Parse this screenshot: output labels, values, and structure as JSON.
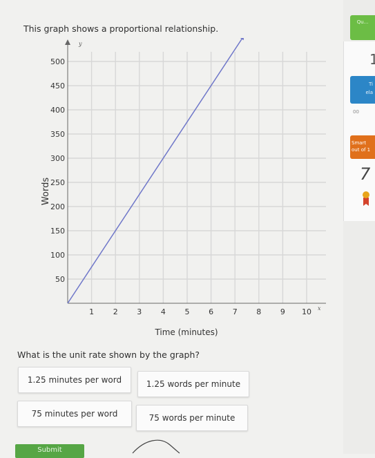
{
  "question": {
    "prompt": "This graph shows a proportional relationship.",
    "ask": "What is the unit rate shown by the graph?"
  },
  "chart_data": {
    "type": "line",
    "xlabel": "Time (minutes)",
    "ylabel": "Words",
    "x_ticks": [
      1,
      2,
      3,
      4,
      5,
      6,
      7,
      8,
      9,
      10
    ],
    "y_ticks": [
      50,
      100,
      150,
      200,
      250,
      300,
      350,
      400,
      450,
      500
    ],
    "xlim": [
      0,
      11
    ],
    "ylim": [
      0,
      520
    ],
    "grid": true,
    "series": [
      {
        "x": [
          0,
          1,
          2,
          3,
          4,
          5,
          6,
          7,
          8
        ],
        "y": [
          0,
          75,
          150,
          225,
          300,
          375,
          450,
          525,
          600
        ]
      }
    ],
    "axis_letters": {
      "x": "x",
      "y": "y"
    },
    "colors": {
      "line": "#6f77c9",
      "grid": "#d7d7d7",
      "axis": "#666666"
    }
  },
  "choices": [
    {
      "label": "1.25 minutes per word"
    },
    {
      "label": "1.25 words per minute"
    },
    {
      "label": "75 minutes per word"
    },
    {
      "label": "75 words per minute"
    }
  ],
  "submit_label": "Submit",
  "panel": {
    "tab1": "Qu...",
    "count": "1",
    "tab2": "Ti\nela",
    "mini": "00",
    "tab3": "Smart\nout of 1",
    "score": "7"
  }
}
